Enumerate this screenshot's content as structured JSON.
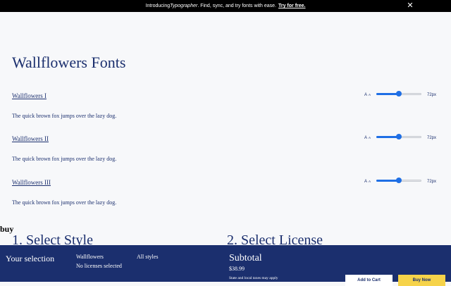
{
  "banner": {
    "prefix": "Introducing ",
    "product": "Typographer",
    "suffix": ". Find, sync, and try fonts with ease.",
    "cta": "Try for free.",
    "close_icon": "close-icon"
  },
  "page": {
    "title": "Wallflowers Fonts"
  },
  "fonts": [
    {
      "name": "Wallflowers I",
      "sample": "The quick brown fox jumps over the lazy dog.",
      "aa_big": "A",
      "aa_small": "A",
      "size_label": "72px",
      "size_level": 0.5
    },
    {
      "name": "Wallflowers II",
      "sample": "The quick brown fox jumps over the lazy dog.",
      "aa_big": "A",
      "aa_small": "A",
      "size_label": "72px",
      "size_level": 0.5
    },
    {
      "name": "Wallflowers III",
      "sample": "The quick brown fox jumps over the lazy dog.",
      "aa_big": "A",
      "aa_small": "A",
      "size_label": "72px",
      "size_level": 0.5
    }
  ],
  "buy": {
    "label": "buy",
    "step1": "1. Select Style",
    "step2": "2. Select License"
  },
  "footer": {
    "your_selection": "Your selection",
    "family": "Wallflowers",
    "licenses": "No licenses selected",
    "styles": "All styles",
    "subtotal_label": "Subtotal",
    "price": "$38.99",
    "tax_note": "State and local taxes may apply",
    "add_to_cart": "Add to Cart",
    "buy_now": "Buy Now"
  },
  "colors": {
    "navy": "#1b2f6e",
    "accent": "#1f6fe5",
    "buy_button": "#f6d34a"
  }
}
